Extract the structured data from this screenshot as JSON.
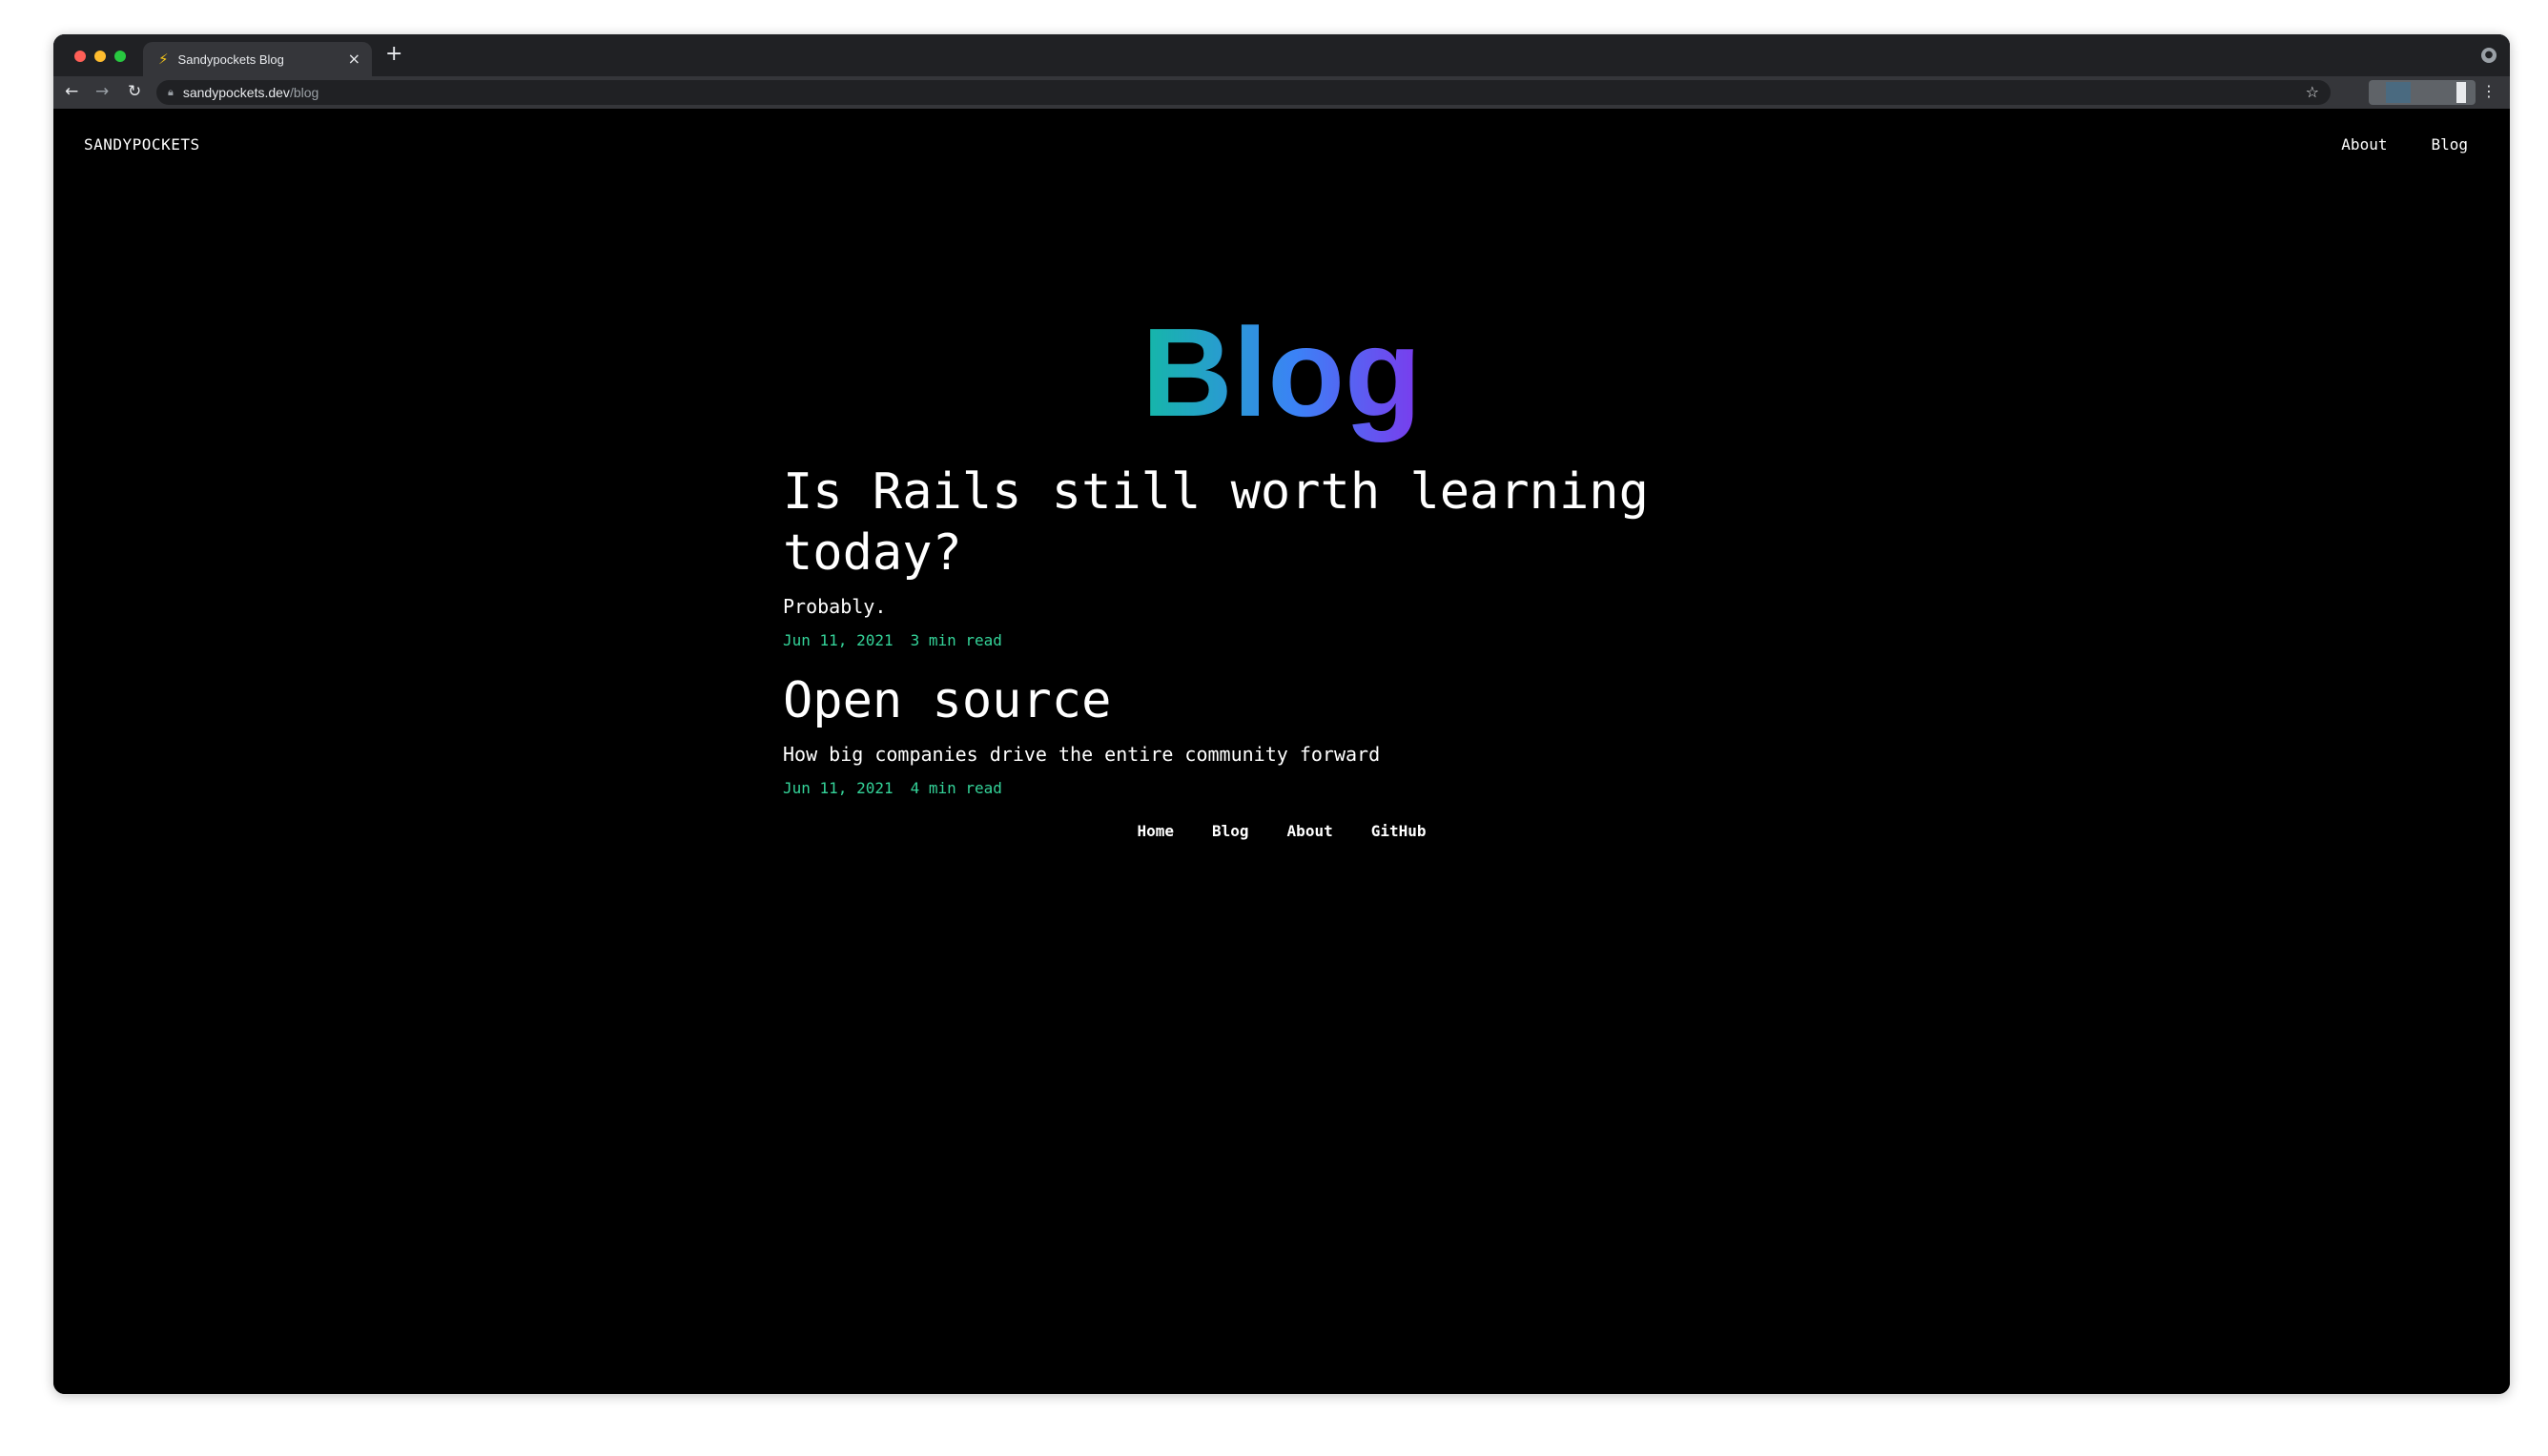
{
  "browser": {
    "tab_title": "Sandypockets Blog",
    "tab_favicon": "⚡",
    "url_host": "sandypockets.dev",
    "url_path": "/blog"
  },
  "site": {
    "logo": "SANDYPOCKETS",
    "nav": [
      {
        "label": "About"
      },
      {
        "label": "Blog"
      }
    ]
  },
  "hero": {
    "title": "Blog",
    "gradient": [
      "#14b8a6",
      "#3b82f6",
      "#7c3aed"
    ]
  },
  "posts": [
    {
      "title": "Is Rails still worth learning today?",
      "description": "Probably.",
      "date": "Jun 11, 2021",
      "read_time": "3 min read"
    },
    {
      "title": "Open source",
      "description": "How big companies drive the entire community forward",
      "date": "Jun 11, 2021",
      "read_time": "4 min read"
    }
  ],
  "footer": {
    "links": [
      {
        "label": "Home"
      },
      {
        "label": "Blog"
      },
      {
        "label": "About"
      },
      {
        "label": "GitHub"
      }
    ]
  },
  "colors": {
    "background": "#000000",
    "text": "#ffffff",
    "meta_accent": "#34d399"
  }
}
